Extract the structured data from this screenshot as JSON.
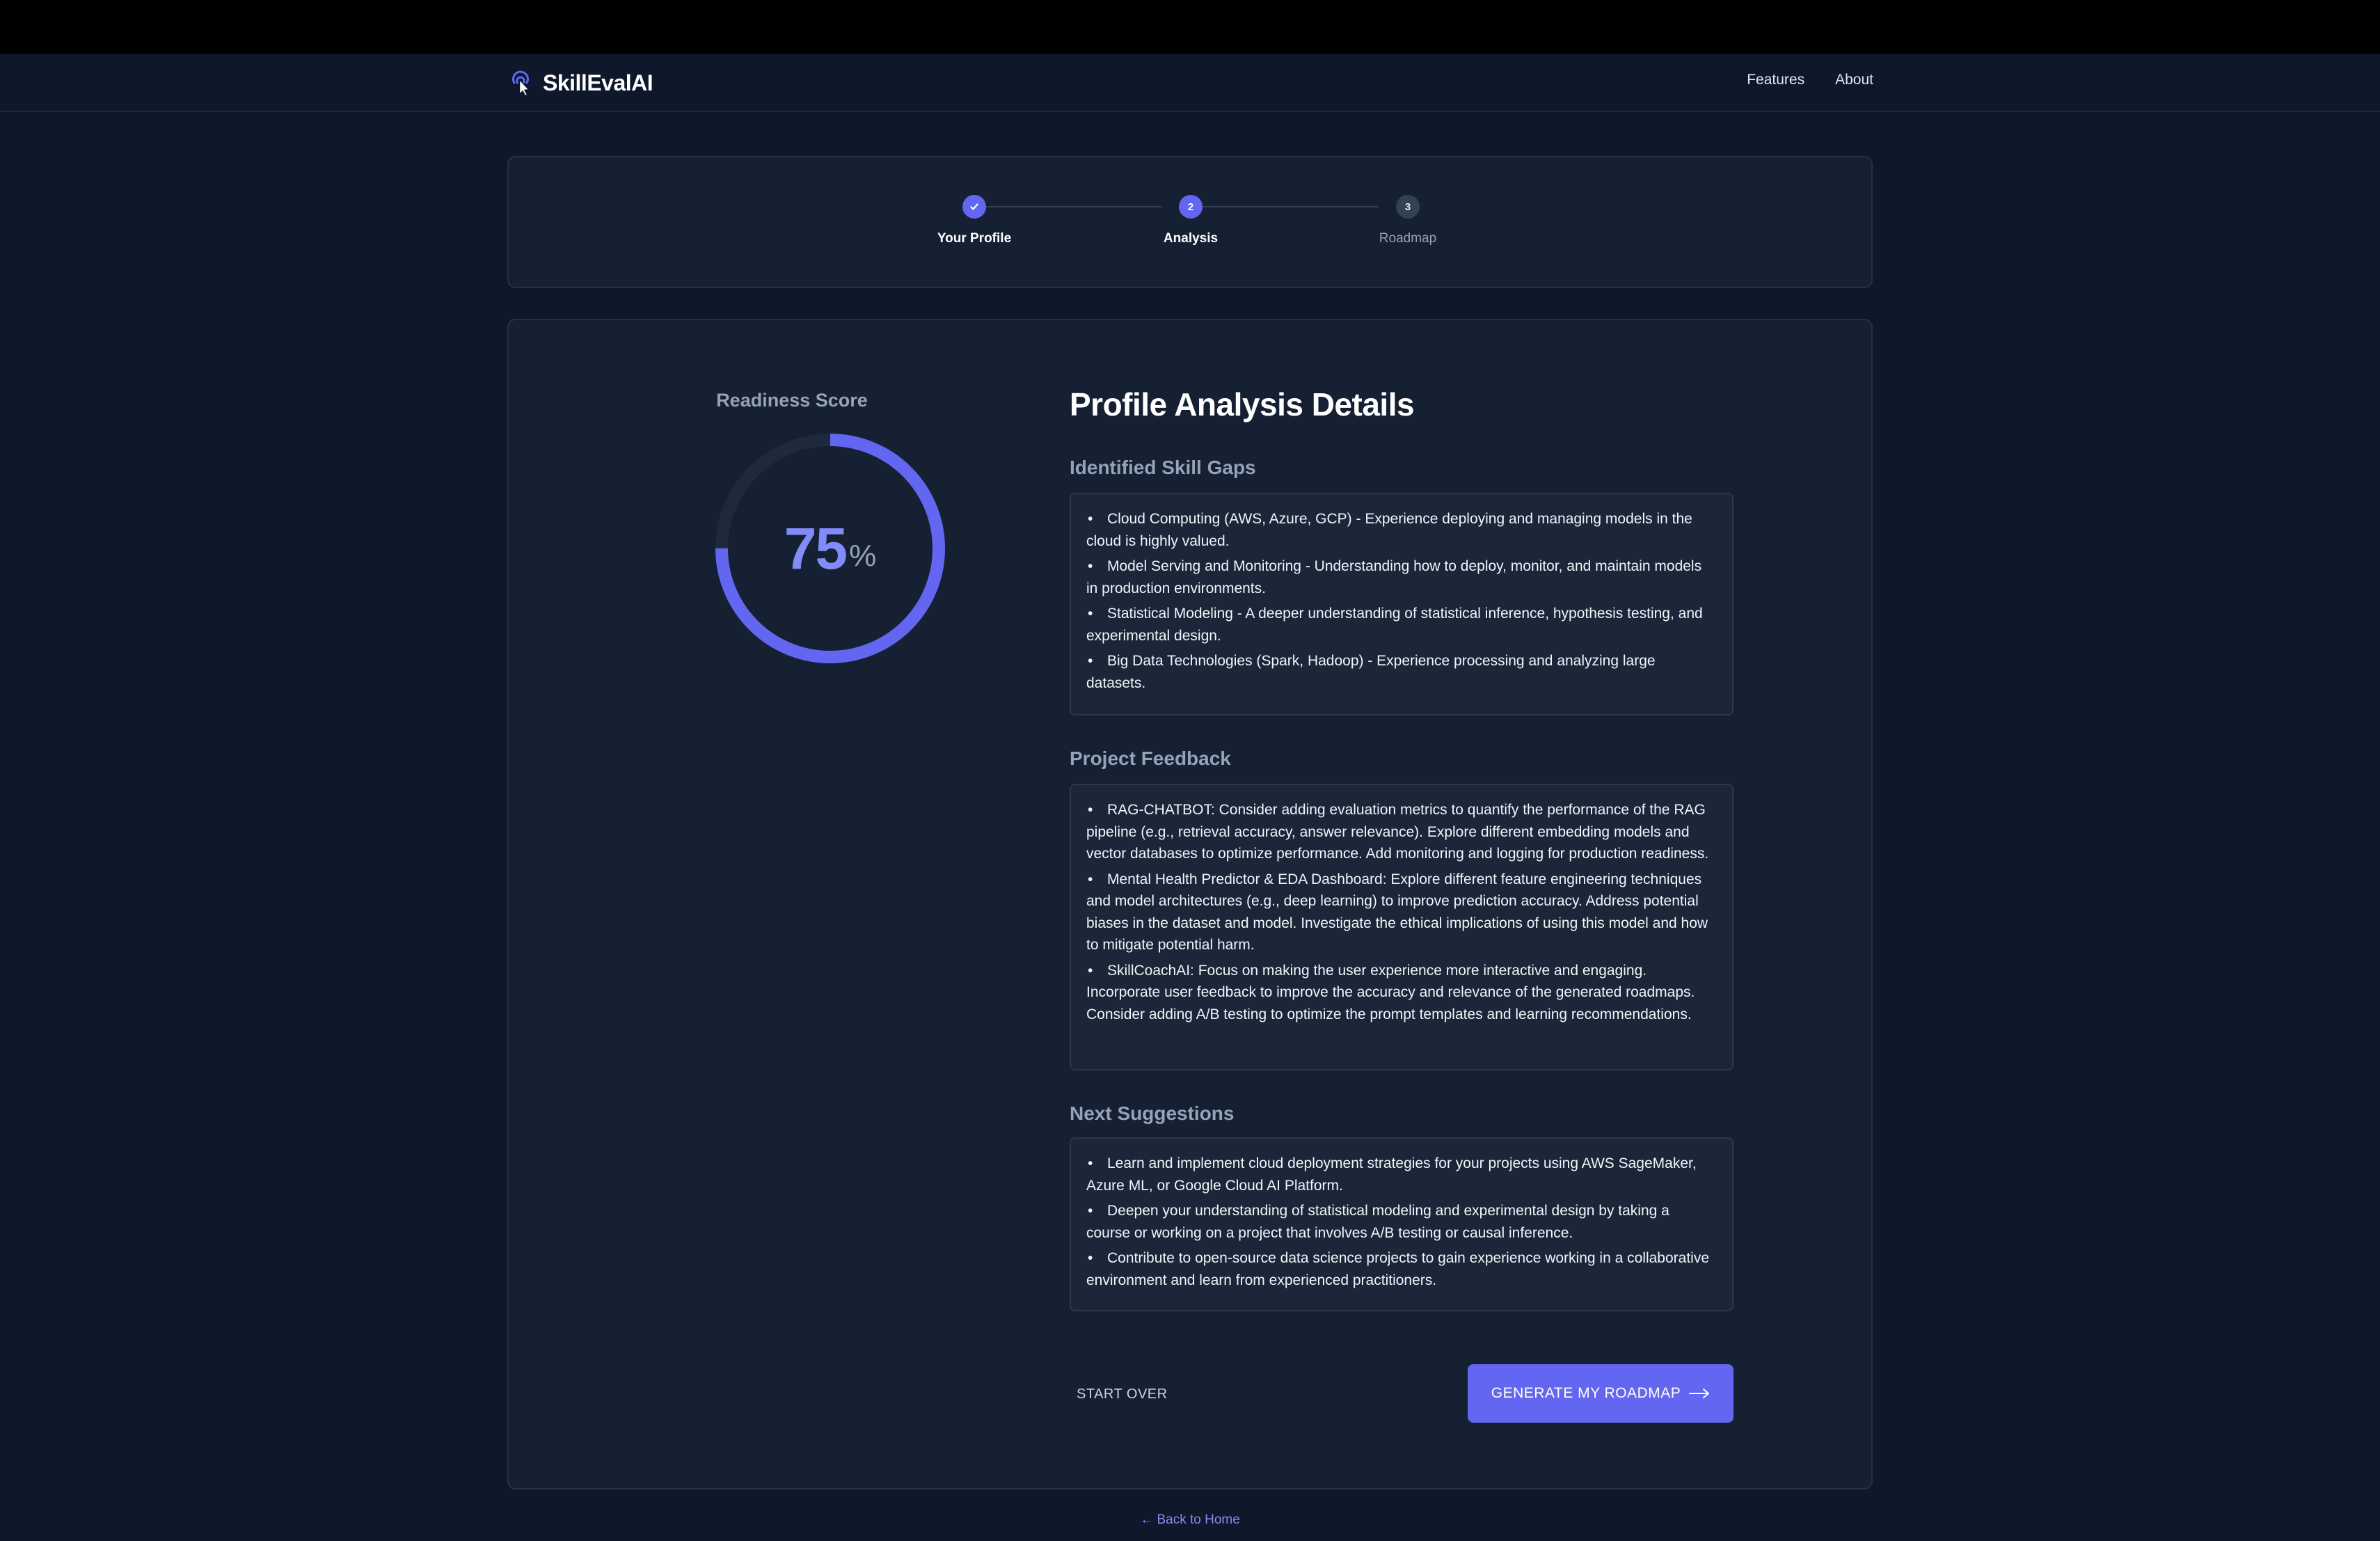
{
  "app": {
    "brand": "SkillEvalAI",
    "logo_icon": "pointer-click-icon"
  },
  "nav": {
    "features": "Features",
    "about": "About"
  },
  "stepper": {
    "steps": [
      {
        "label": "Your Profile",
        "marker": "",
        "state": "done",
        "icon": "check-icon"
      },
      {
        "label": "Analysis",
        "marker": "2",
        "state": "active"
      },
      {
        "label": "Roadmap",
        "marker": "3",
        "state": "pending"
      }
    ]
  },
  "score": {
    "title": "Readiness Score",
    "value": "75",
    "unit": "%",
    "fraction": 0.75
  },
  "analysis": {
    "title": "Profile Analysis Details",
    "skill_gaps": {
      "title": "Identified Skill Gaps",
      "items": [
        "Cloud Computing (AWS, Azure, GCP) - Experience deploying and managing models in the cloud is highly valued.",
        "Model Serving and Monitoring - Understanding how to deploy, monitor, and maintain models in production environments.",
        "Statistical Modeling - A deeper understanding of statistical inference, hypothesis testing, and experimental design.",
        "Big Data Technologies (Spark, Hadoop) - Experience processing and analyzing large datasets."
      ]
    },
    "project_feedback": {
      "title": "Project Feedback",
      "items": [
        "RAG-CHATBOT: Consider adding evaluation metrics to quantify the performance of the RAG pipeline (e.g., retrieval accuracy, answer relevance). Explore different embedding models and vector databases to optimize performance. Add monitoring and logging for production readiness.",
        "Mental Health Predictor & EDA Dashboard: Explore different feature engineering techniques and model architectures (e.g., deep learning) to improve prediction accuracy. Address potential biases in the dataset and model. Investigate the ethical implications of using this model and how to mitigate potential harm.",
        "SkillCoachAI: Focus on making the user experience more interactive and engaging. Incorporate user feedback to improve the accuracy and relevance of the generated roadmaps. Consider adding A/B testing to optimize the prompt templates and learning recommendations."
      ]
    },
    "next_suggestions": {
      "title": "Next Suggestions",
      "items": [
        "Learn and implement cloud deployment strategies for your projects using AWS SageMaker, Azure ML, or Google Cloud AI Platform.",
        "Deepen your understanding of statistical modeling and experimental design by taking a course or working on a project that involves A/B testing or causal inference.",
        "Contribute to open-source data science projects to gain experience working in a collaborative environment and learn from experienced practitioners."
      ]
    }
  },
  "actions": {
    "start_over": "START OVER",
    "generate": "GENERATE MY ROADMAP",
    "generate_icon": "arrow-right-icon"
  },
  "footer": {
    "back_home": "← Back to Home"
  },
  "colors": {
    "background": "#0f172a",
    "card": "#162033",
    "accent": "#6366f1",
    "accent_light": "#818cf8",
    "muted": "#94a3b8"
  }
}
